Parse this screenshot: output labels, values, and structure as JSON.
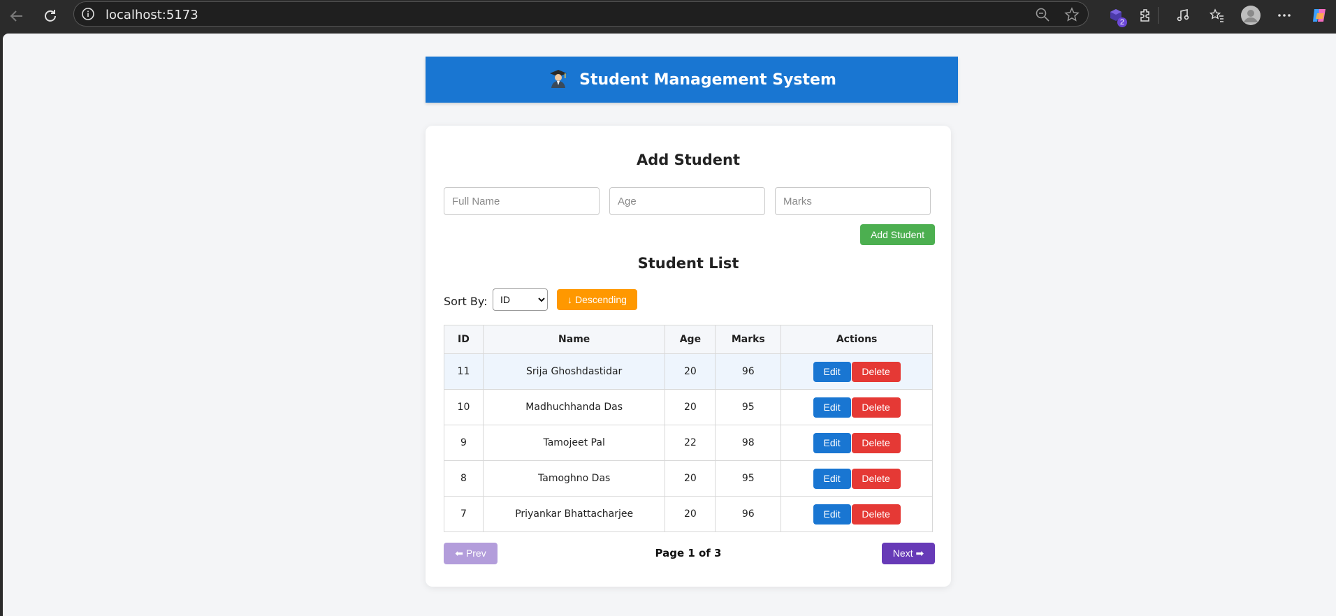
{
  "browser": {
    "url": "localhost:5173",
    "extension_badge": "2"
  },
  "app": {
    "title": "Student Management System",
    "header_color": "#1976d2"
  },
  "add_form": {
    "heading": "Add Student",
    "name_placeholder": "Full Name",
    "age_placeholder": "Age",
    "marks_placeholder": "Marks",
    "submit_label": "Add Student"
  },
  "list": {
    "heading": "Student List",
    "sort_label": "Sort By:",
    "sort_value": "ID",
    "order_label": "↓ Descending",
    "columns": [
      "ID",
      "Name",
      "Age",
      "Marks",
      "Actions"
    ],
    "rows": [
      {
        "id": "11",
        "name": "Srija Ghoshdastidar",
        "age": "20",
        "marks": "96"
      },
      {
        "id": "10",
        "name": "Madhuchhanda Das",
        "age": "20",
        "marks": "95"
      },
      {
        "id": "9",
        "name": "Tamojeet Pal",
        "age": "22",
        "marks": "98"
      },
      {
        "id": "8",
        "name": "Tamoghno Das",
        "age": "20",
        "marks": "95"
      },
      {
        "id": "7",
        "name": "Priyankar Bhattacharjee",
        "age": "20",
        "marks": "96"
      }
    ],
    "edit_label": "Edit",
    "delete_label": "Delete"
  },
  "pagination": {
    "prev_label": "⬅ Prev",
    "page_info": "Page 1 of 3",
    "next_label": "Next ➡"
  },
  "colors": {
    "add": "#4caf50",
    "order": "#ff9800",
    "edit": "#1976d2",
    "delete": "#e53935",
    "prev": "#b39ddb",
    "next": "#673ab7"
  }
}
